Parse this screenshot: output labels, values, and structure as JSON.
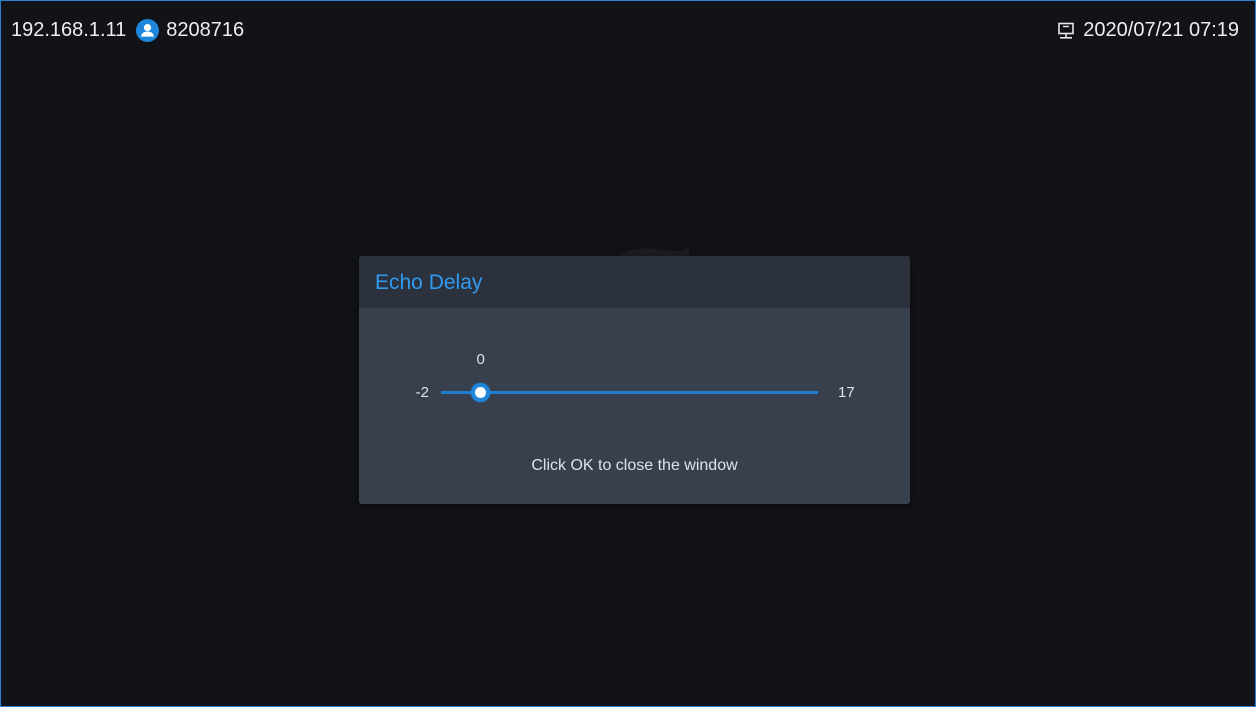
{
  "status_bar": {
    "ip_address": "192.168.1.11",
    "account_icon": "user-circle-icon",
    "account_number": "8208716",
    "network_icon": "wired-network-icon",
    "datetime": "2020/07/21 07:19"
  },
  "dialog": {
    "title": "Echo Delay",
    "slider": {
      "value_label": "0",
      "min_label": "-2",
      "max_label": "17",
      "min": -2,
      "max": 17,
      "value": 0
    },
    "hint": "Click OK to close the window"
  },
  "colors": {
    "accent": "#1f86dc",
    "title": "#2e9bf0",
    "background": "#121318",
    "dialog_body": "#383f4d",
    "dialog_header": "#2b313d"
  }
}
